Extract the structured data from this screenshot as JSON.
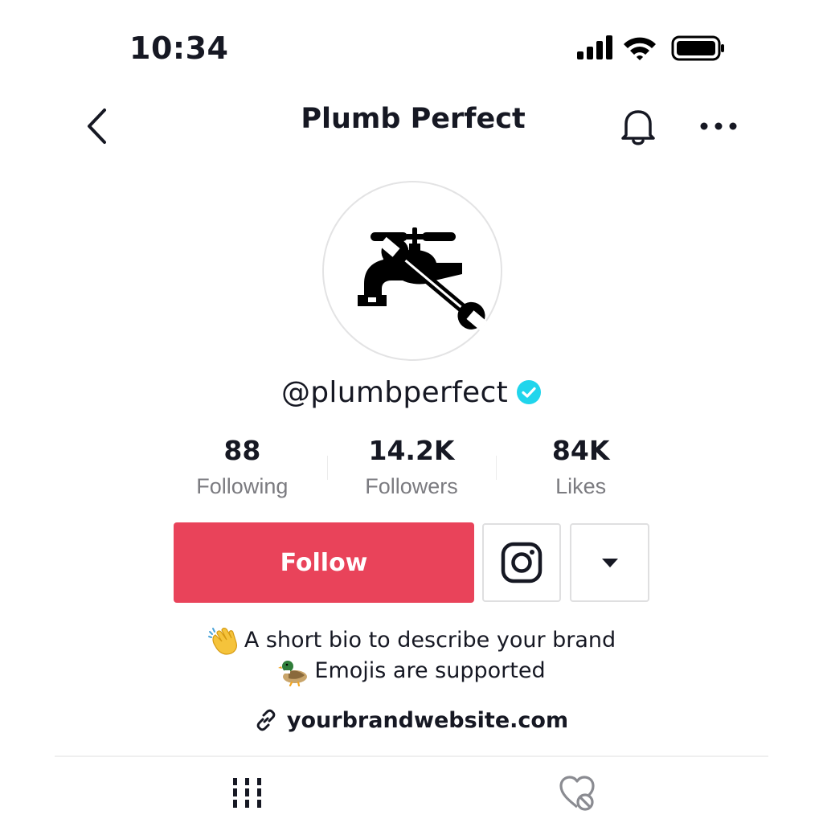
{
  "status_bar": {
    "time": "10:34"
  },
  "header": {
    "title": "Plumb Perfect"
  },
  "profile": {
    "username": "@plumbperfect",
    "verified": true,
    "verified_color": "#20d5ec"
  },
  "stats": [
    {
      "value": "88",
      "label": "Following"
    },
    {
      "value": "14.2K",
      "label": "Followers"
    },
    {
      "value": "84K",
      "label": "Likes"
    }
  ],
  "actions": {
    "follow_label": "Follow",
    "follow_color": "#e9435a",
    "instagram_icon": "instagram-icon",
    "dropdown_icon": "caret-down-icon"
  },
  "bio": {
    "line1_emoji": "waving-hand",
    "line1_text": "A short bio to describe your brand",
    "line2_emoji": "duck",
    "line2_text": "Emojis are supported"
  },
  "website": {
    "icon": "link-icon",
    "text": "yourbrandwebsite.com"
  },
  "tabs": [
    {
      "icon": "videos-grid-icon",
      "active": true
    },
    {
      "icon": "liked-hidden-icon",
      "active": false
    }
  ]
}
